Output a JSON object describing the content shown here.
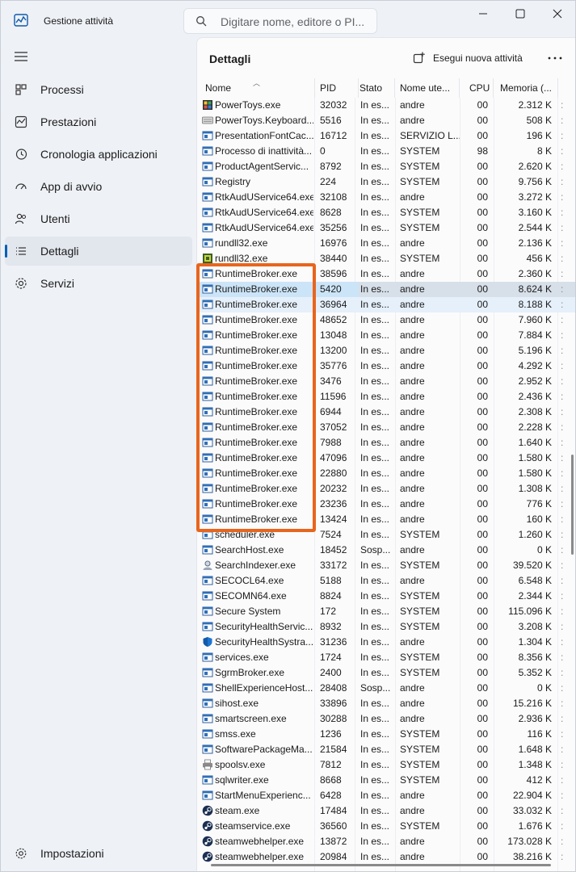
{
  "app": {
    "title": "Gestione attività",
    "search_placeholder": "Digitare nome, editore o PI..."
  },
  "sidebar": {
    "items": [
      {
        "label": "Processi",
        "icon": "processes-icon"
      },
      {
        "label": "Prestazioni",
        "icon": "performance-icon"
      },
      {
        "label": "Cronologia applicazioni",
        "icon": "history-icon"
      },
      {
        "label": "App di avvio",
        "icon": "startup-icon"
      },
      {
        "label": "Utenti",
        "icon": "users-icon"
      },
      {
        "label": "Dettagli",
        "icon": "details-icon",
        "active": true
      },
      {
        "label": "Servizi",
        "icon": "services-icon"
      }
    ],
    "settings_label": "Impostazioni"
  },
  "main": {
    "title": "Dettagli",
    "new_task_label": "Esegui nuova attività"
  },
  "table": {
    "columns": {
      "name": "Nome",
      "pid": "PID",
      "status": "Stato",
      "user": "Nome ute...",
      "cpu": "CPU",
      "memory": "Memoria (..."
    },
    "rows": [
      {
        "name": "PowerToys.exe",
        "pid": "32032",
        "status": "In es...",
        "user": "andre",
        "cpu": "00",
        "mem": "2.312 K",
        "icon": "powertoys"
      },
      {
        "name": "PowerToys.Keyboard...",
        "pid": "5516",
        "status": "In es...",
        "user": "andre",
        "cpu": "00",
        "mem": "508 K",
        "icon": "keyboard"
      },
      {
        "name": "PresentationFontCac...",
        "pid": "16712",
        "status": "In es...",
        "user": "SERVIZIO L...",
        "cpu": "00",
        "mem": "196 K",
        "icon": "app"
      },
      {
        "name": "Processo di inattività...",
        "pid": "0",
        "status": "In es...",
        "user": "SYSTEM",
        "cpu": "98",
        "mem": "8 K",
        "icon": "app"
      },
      {
        "name": "ProductAgentServic...",
        "pid": "8792",
        "status": "In es...",
        "user": "SYSTEM",
        "cpu": "00",
        "mem": "2.620 K",
        "icon": "app"
      },
      {
        "name": "Registry",
        "pid": "224",
        "status": "In es...",
        "user": "SYSTEM",
        "cpu": "00",
        "mem": "9.756 K",
        "icon": "app"
      },
      {
        "name": "RtkAudUService64.exe",
        "pid": "32108",
        "status": "In es...",
        "user": "andre",
        "cpu": "00",
        "mem": "3.272 K",
        "icon": "app"
      },
      {
        "name": "RtkAudUService64.exe",
        "pid": "8628",
        "status": "In es...",
        "user": "SYSTEM",
        "cpu": "00",
        "mem": "3.160 K",
        "icon": "app"
      },
      {
        "name": "RtkAudUService64.exe",
        "pid": "35256",
        "status": "In es...",
        "user": "SYSTEM",
        "cpu": "00",
        "mem": "2.544 K",
        "icon": "app"
      },
      {
        "name": "rundll32.exe",
        "pid": "16976",
        "status": "In es...",
        "user": "andre",
        "cpu": "00",
        "mem": "2.136 K",
        "icon": "app"
      },
      {
        "name": "rundll32.exe",
        "pid": "38440",
        "status": "In es...",
        "user": "SYSTEM",
        "cpu": "00",
        "mem": "456 K",
        "icon": "chip"
      },
      {
        "name": "RuntimeBroker.exe",
        "pid": "38596",
        "status": "In es...",
        "user": "andre",
        "cpu": "00",
        "mem": "2.360 K",
        "icon": "app"
      },
      {
        "name": "RuntimeBroker.exe",
        "pid": "5420",
        "status": "In es...",
        "user": "andre",
        "cpu": "00",
        "mem": "8.624 K",
        "icon": "app",
        "sel": "sel1"
      },
      {
        "name": "RuntimeBroker.exe",
        "pid": "36964",
        "status": "In es...",
        "user": "andre",
        "cpu": "00",
        "mem": "8.188 K",
        "icon": "app",
        "sel": "sel2"
      },
      {
        "name": "RuntimeBroker.exe",
        "pid": "48652",
        "status": "In es...",
        "user": "andre",
        "cpu": "00",
        "mem": "7.960 K",
        "icon": "app"
      },
      {
        "name": "RuntimeBroker.exe",
        "pid": "13048",
        "status": "In es...",
        "user": "andre",
        "cpu": "00",
        "mem": "7.884 K",
        "icon": "app"
      },
      {
        "name": "RuntimeBroker.exe",
        "pid": "13200",
        "status": "In es...",
        "user": "andre",
        "cpu": "00",
        "mem": "5.196 K",
        "icon": "app"
      },
      {
        "name": "RuntimeBroker.exe",
        "pid": "35776",
        "status": "In es...",
        "user": "andre",
        "cpu": "00",
        "mem": "4.292 K",
        "icon": "app"
      },
      {
        "name": "RuntimeBroker.exe",
        "pid": "3476",
        "status": "In es...",
        "user": "andre",
        "cpu": "00",
        "mem": "2.952 K",
        "icon": "app"
      },
      {
        "name": "RuntimeBroker.exe",
        "pid": "11596",
        "status": "In es...",
        "user": "andre",
        "cpu": "00",
        "mem": "2.436 K",
        "icon": "app"
      },
      {
        "name": "RuntimeBroker.exe",
        "pid": "6944",
        "status": "In es...",
        "user": "andre",
        "cpu": "00",
        "mem": "2.308 K",
        "icon": "app"
      },
      {
        "name": "RuntimeBroker.exe",
        "pid": "37052",
        "status": "In es...",
        "user": "andre",
        "cpu": "00",
        "mem": "2.228 K",
        "icon": "app"
      },
      {
        "name": "RuntimeBroker.exe",
        "pid": "7988",
        "status": "In es...",
        "user": "andre",
        "cpu": "00",
        "mem": "1.640 K",
        "icon": "app"
      },
      {
        "name": "RuntimeBroker.exe",
        "pid": "47096",
        "status": "In es...",
        "user": "andre",
        "cpu": "00",
        "mem": "1.580 K",
        "icon": "app"
      },
      {
        "name": "RuntimeBroker.exe",
        "pid": "22880",
        "status": "In es...",
        "user": "andre",
        "cpu": "00",
        "mem": "1.580 K",
        "icon": "app"
      },
      {
        "name": "RuntimeBroker.exe",
        "pid": "20232",
        "status": "In es...",
        "user": "andre",
        "cpu": "00",
        "mem": "1.308 K",
        "icon": "app"
      },
      {
        "name": "RuntimeBroker.exe",
        "pid": "23236",
        "status": "In es...",
        "user": "andre",
        "cpu": "00",
        "mem": "776 K",
        "icon": "app"
      },
      {
        "name": "RuntimeBroker.exe",
        "pid": "13424",
        "status": "In es...",
        "user": "andre",
        "cpu": "00",
        "mem": "160 K",
        "icon": "app"
      },
      {
        "name": "scheduler.exe",
        "pid": "7524",
        "status": "In es...",
        "user": "SYSTEM",
        "cpu": "00",
        "mem": "1.260 K",
        "icon": "app"
      },
      {
        "name": "SearchHost.exe",
        "pid": "18452",
        "status": "Sosp...",
        "user": "andre",
        "cpu": "00",
        "mem": "0 K",
        "icon": "app"
      },
      {
        "name": "SearchIndexer.exe",
        "pid": "33172",
        "status": "In es...",
        "user": "SYSTEM",
        "cpu": "00",
        "mem": "39.520 K",
        "icon": "search"
      },
      {
        "name": "SECOCL64.exe",
        "pid": "5188",
        "status": "In es...",
        "user": "andre",
        "cpu": "00",
        "mem": "6.548 K",
        "icon": "app"
      },
      {
        "name": "SECOMN64.exe",
        "pid": "8824",
        "status": "In es...",
        "user": "SYSTEM",
        "cpu": "00",
        "mem": "2.344 K",
        "icon": "app"
      },
      {
        "name": "Secure System",
        "pid": "172",
        "status": "In es...",
        "user": "SYSTEM",
        "cpu": "00",
        "mem": "115.096 K",
        "icon": "app"
      },
      {
        "name": "SecurityHealthServic...",
        "pid": "8932",
        "status": "In es...",
        "user": "SYSTEM",
        "cpu": "00",
        "mem": "3.208 K",
        "icon": "app"
      },
      {
        "name": "SecurityHealthSystra...",
        "pid": "31236",
        "status": "In es...",
        "user": "andre",
        "cpu": "00",
        "mem": "1.304 K",
        "icon": "shield"
      },
      {
        "name": "services.exe",
        "pid": "1724",
        "status": "In es...",
        "user": "SYSTEM",
        "cpu": "00",
        "mem": "8.356 K",
        "icon": "app"
      },
      {
        "name": "SgrmBroker.exe",
        "pid": "2400",
        "status": "In es...",
        "user": "SYSTEM",
        "cpu": "00",
        "mem": "5.352 K",
        "icon": "app"
      },
      {
        "name": "ShellExperienceHost...",
        "pid": "28408",
        "status": "Sosp...",
        "user": "andre",
        "cpu": "00",
        "mem": "0 K",
        "icon": "app"
      },
      {
        "name": "sihost.exe",
        "pid": "33896",
        "status": "In es...",
        "user": "andre",
        "cpu": "00",
        "mem": "15.216 K",
        "icon": "app"
      },
      {
        "name": "smartscreen.exe",
        "pid": "30288",
        "status": "In es...",
        "user": "andre",
        "cpu": "00",
        "mem": "2.936 K",
        "icon": "app"
      },
      {
        "name": "smss.exe",
        "pid": "1236",
        "status": "In es...",
        "user": "SYSTEM",
        "cpu": "00",
        "mem": "116 K",
        "icon": "app"
      },
      {
        "name": "SoftwarePackageMa...",
        "pid": "21584",
        "status": "In es...",
        "user": "SYSTEM",
        "cpu": "00",
        "mem": "1.648 K",
        "icon": "app"
      },
      {
        "name": "spoolsv.exe",
        "pid": "7812",
        "status": "In es...",
        "user": "SYSTEM",
        "cpu": "00",
        "mem": "1.348 K",
        "icon": "printer"
      },
      {
        "name": "sqlwriter.exe",
        "pid": "8668",
        "status": "In es...",
        "user": "SYSTEM",
        "cpu": "00",
        "mem": "412 K",
        "icon": "app"
      },
      {
        "name": "StartMenuExperienc...",
        "pid": "6428",
        "status": "In es...",
        "user": "andre",
        "cpu": "00",
        "mem": "22.904 K",
        "icon": "app"
      },
      {
        "name": "steam.exe",
        "pid": "17484",
        "status": "In es...",
        "user": "andre",
        "cpu": "00",
        "mem": "33.032 K",
        "icon": "steam"
      },
      {
        "name": "steamservice.exe",
        "pid": "36560",
        "status": "In es...",
        "user": "SYSTEM",
        "cpu": "00",
        "mem": "1.676 K",
        "icon": "steam"
      },
      {
        "name": "steamwebhelper.exe",
        "pid": "13872",
        "status": "In es...",
        "user": "andre",
        "cpu": "00",
        "mem": "173.028 K",
        "icon": "steam"
      },
      {
        "name": "steamwebhelper.exe",
        "pid": "20984",
        "status": "In es...",
        "user": "andre",
        "cpu": "00",
        "mem": "38.216 K",
        "icon": "steam"
      }
    ]
  },
  "colors": {
    "accent": "#005fb8",
    "highlight_box": "#e8651d",
    "selected_row": "#cce4f7"
  }
}
